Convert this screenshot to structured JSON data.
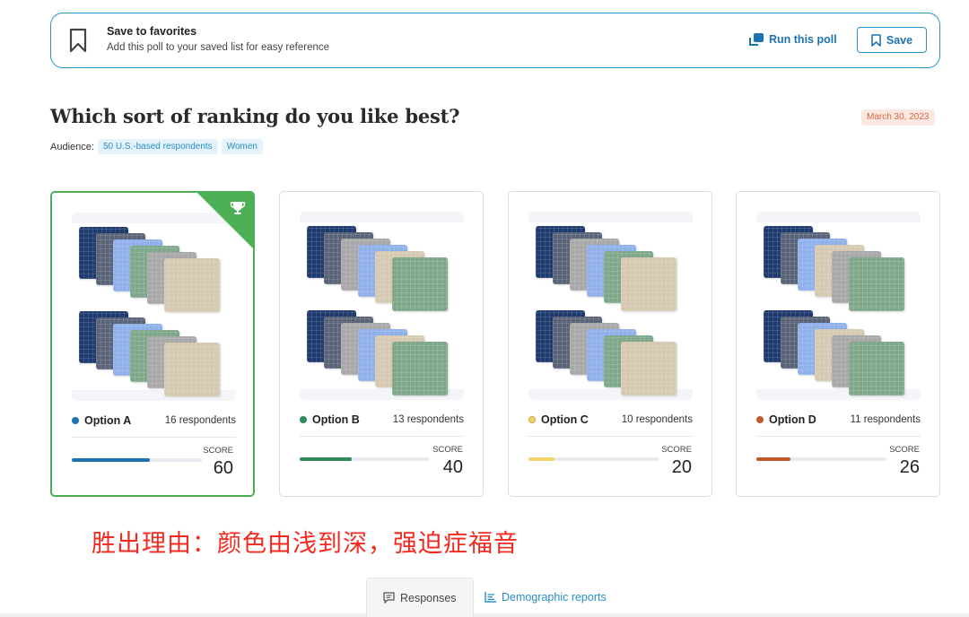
{
  "favorites_banner": {
    "title": "Save to favorites",
    "subtitle": "Add this poll to your saved list for easy reference",
    "icon": "bookmark-icon",
    "run_poll_label": "Run this poll",
    "run_poll_icon": "copy-icon",
    "save_label": "Save",
    "save_icon": "bookmark-icon"
  },
  "poll": {
    "title": "Which sort of ranking do you like best?",
    "date": "March 30, 2023",
    "audience_label": "Audience:",
    "audience_tags": [
      "50 U.S.-based respondents",
      "Women"
    ]
  },
  "options": [
    {
      "label": "Option A",
      "respondents": "16 respondents",
      "score_label": "SCORE",
      "score": "60",
      "score_percent": 60,
      "color": "#1b73b3",
      "winner": true,
      "winner_icon": "trophy-icon",
      "towel_colors": [
        "#1f3a6e",
        "#5a6478",
        "#8fb0ea",
        "#7fa78a",
        "#a8a8a8",
        "#d6c9b1"
      ]
    },
    {
      "label": "Option B",
      "respondents": "13 respondents",
      "score_label": "SCORE",
      "score": "40",
      "score_percent": 40,
      "color": "#2e8b57",
      "winner": false,
      "towel_colors": [
        "#1f3a6e",
        "#5a6478",
        "#a8a8a8",
        "#8fb0ea",
        "#d6c9b1",
        "#7fa78a"
      ]
    },
    {
      "label": "Option C",
      "respondents": "10 respondents",
      "score_label": "SCORE",
      "score": "20",
      "score_percent": 20,
      "color": "#f2d46b",
      "winner": false,
      "towel_colors": [
        "#1f3a6e",
        "#5a6478",
        "#a8a8a8",
        "#8fb0ea",
        "#7fa78a",
        "#d6c9b1"
      ]
    },
    {
      "label": "Option D",
      "respondents": "11 respondents",
      "score_label": "SCORE",
      "score": "26",
      "score_percent": 26,
      "color": "#c05a2a",
      "winner": false,
      "towel_colors": [
        "#1f3a6e",
        "#5a6478",
        "#8fb0ea",
        "#d6c9b1",
        "#a8a8a8",
        "#7fa78a"
      ]
    }
  ],
  "annotation": "胜出理由：颜色由浅到深，强迫症福音",
  "tabs": [
    {
      "label": "Responses",
      "icon": "message-icon",
      "active": true
    },
    {
      "label": "Demographic reports",
      "icon": "chart-icon",
      "active": false
    }
  ]
}
